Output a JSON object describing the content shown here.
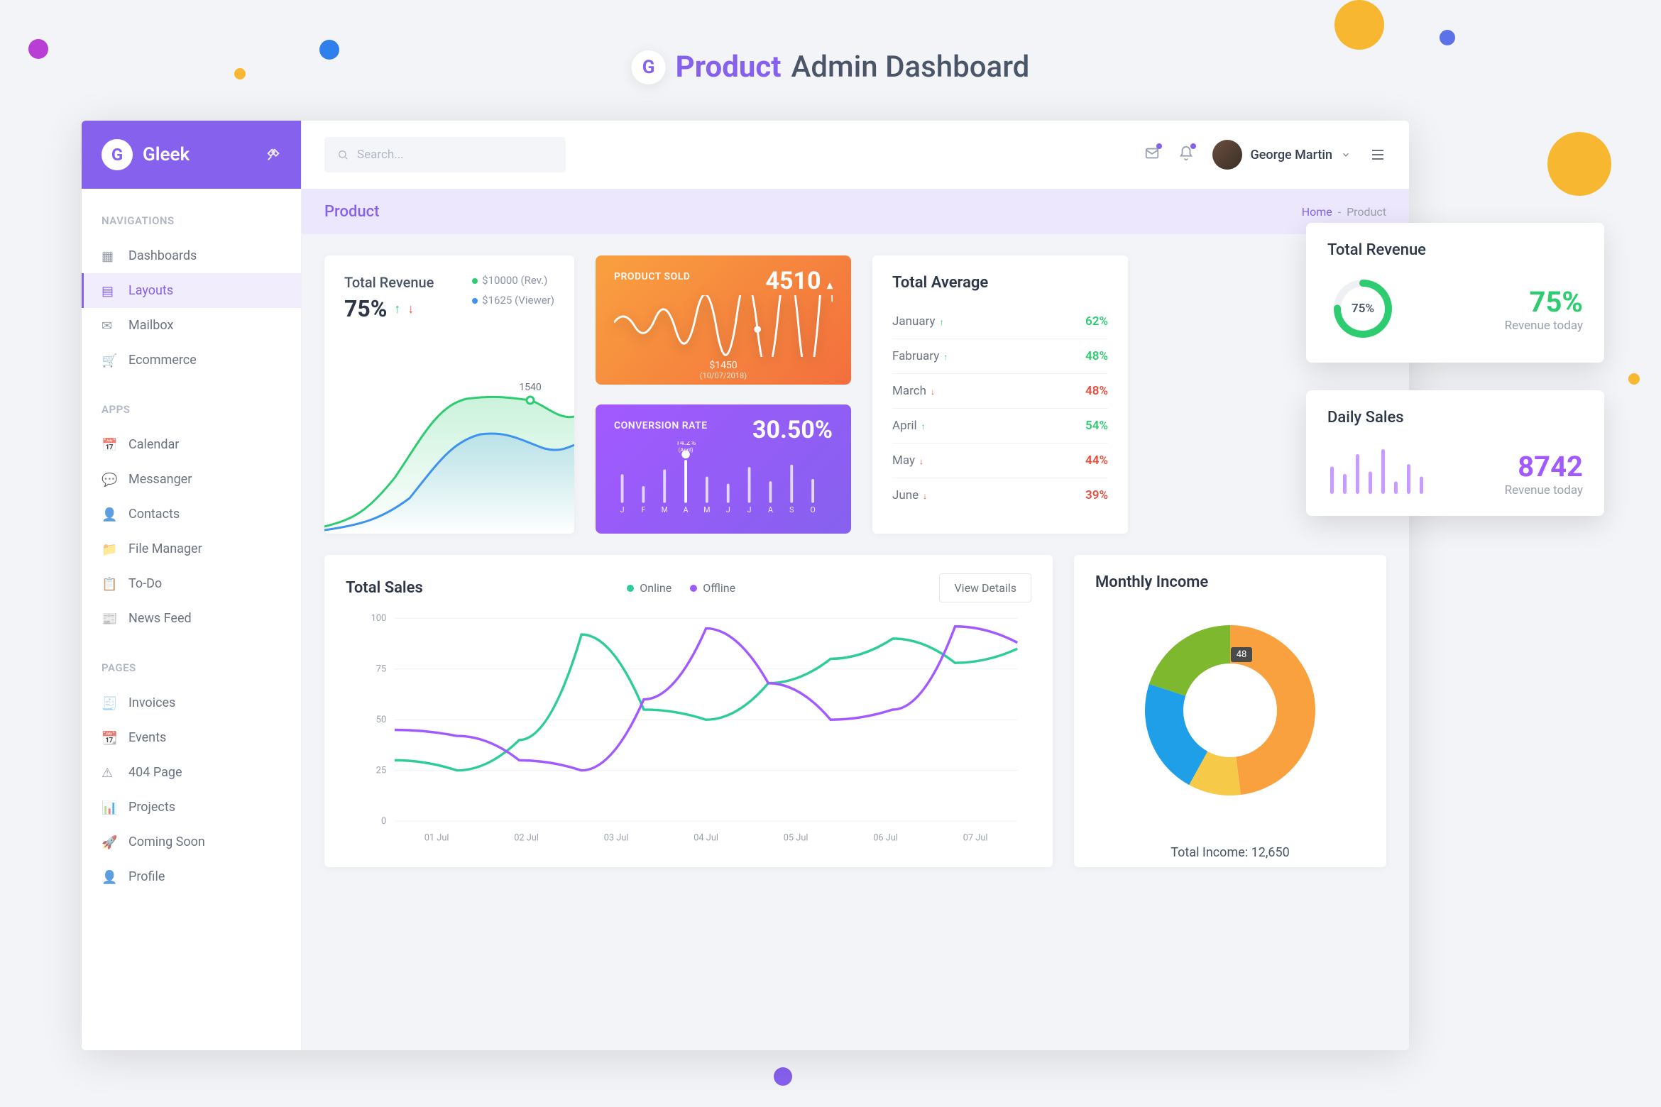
{
  "page_heading": {
    "prefix": "Product",
    "suffix": "Admin Dashboard"
  },
  "brand": "Gleek",
  "search_placeholder": "Search...",
  "user_name": "George Martin",
  "sidebar": {
    "sections": [
      {
        "title": "NAVIGATIONS",
        "items": [
          "Dashboards",
          "Layouts",
          "Mailbox",
          "Ecommerce"
        ]
      },
      {
        "title": "APPS",
        "items": [
          "Calendar",
          "Messanger",
          "Contacts",
          "File Manager",
          "To-Do",
          "News Feed"
        ]
      },
      {
        "title": "PAGES",
        "items": [
          "Invoices",
          "Events",
          "404 Page",
          "Projects",
          "Coming Soon",
          "Profile"
        ]
      }
    ],
    "active": "Layouts"
  },
  "breadcrumb": {
    "title": "Product",
    "home": "Home",
    "current": "Product",
    "sep": "-"
  },
  "total_revenue": {
    "title": "Total Revenue",
    "pct": "75%",
    "legend": [
      {
        "color": "#2ecc71",
        "label": "$10000 (Rev.)"
      },
      {
        "color": "#3e92f0",
        "label": "$1625 (Viewer)"
      }
    ],
    "point_label": "1540"
  },
  "product_sold": {
    "label": "PRODUCT SOLD",
    "value": "4510",
    "tooltip_value": "$1450",
    "tooltip_date": "(10/07/2018)"
  },
  "conversion": {
    "label": "CONVERSION RATE",
    "value": "30.50%",
    "highlight_pct": "14.2%",
    "highlight_month": "(April)",
    "months": [
      "J",
      "F",
      "M",
      "A",
      "M",
      "J",
      "J",
      "A",
      "S",
      "O"
    ]
  },
  "total_average": {
    "title": "Total Average",
    "rows": [
      {
        "month": "January",
        "pct": "62%",
        "dir": "up"
      },
      {
        "month": "Fabruary",
        "pct": "48%",
        "dir": "up"
      },
      {
        "month": "March",
        "pct": "48%",
        "dir": "down"
      },
      {
        "month": "April",
        "pct": "54%",
        "dir": "up"
      },
      {
        "month": "May",
        "pct": "44%",
        "dir": "down"
      },
      {
        "month": "June",
        "pct": "39%",
        "dir": "down"
      }
    ]
  },
  "float_revenue": {
    "title": "Total Revenue",
    "gauge_label": "75%",
    "big": "75%",
    "sub": "Revenue today"
  },
  "float_daily": {
    "title": "Daily Sales",
    "big": "8742",
    "sub": "Revenue today"
  },
  "total_sales": {
    "title": "Total Sales",
    "legend": [
      {
        "color": "#2ecc9b",
        "label": "Online"
      },
      {
        "color": "#a259ff",
        "label": "Offline"
      }
    ],
    "button": "View Details"
  },
  "monthly_income": {
    "title": "Monthly Income",
    "badge": "48",
    "total_label": "Total Income:",
    "total_value": "12,650"
  },
  "chart_data": {
    "total_revenue_spark": {
      "type": "area",
      "series": [
        {
          "name": "Rev.",
          "color": "#2ecc71",
          "values": [
            10,
            15,
            30,
            58,
            70,
            72,
            74,
            78,
            74,
            60,
            62
          ]
        },
        {
          "name": "Viewer",
          "color": "#3e92f0",
          "values": [
            5,
            8,
            18,
            38,
            50,
            56,
            58,
            55,
            48,
            40,
            45
          ]
        }
      ],
      "point": {
        "series": 0,
        "index": 8,
        "label": "1540"
      }
    },
    "product_sold_spark": {
      "type": "line",
      "values": [
        40,
        55,
        35,
        50,
        30,
        45,
        25,
        48,
        28,
        55,
        38,
        60,
        50,
        72,
        80
      ],
      "style": "white-squiggle"
    },
    "conversion_bars": {
      "type": "bar",
      "categories": [
        "J",
        "F",
        "M",
        "A",
        "M",
        "J",
        "J",
        "A",
        "S",
        "O"
      ],
      "values": [
        60,
        35,
        70,
        90,
        55,
        40,
        75,
        45,
        80,
        50
      ],
      "highlight_index": 3
    },
    "float_revenue_gauge": {
      "type": "gauge",
      "pct": 75,
      "color": "#2ecc71"
    },
    "daily_sales_bars": {
      "type": "bar",
      "values": [
        55,
        40,
        80,
        45,
        90,
        25,
        60,
        35
      ],
      "color": "#a259ff"
    },
    "total_sales_lines": {
      "type": "line",
      "x": [
        "01 Jul",
        "02 Jul",
        "03 Jul",
        "04 Jul",
        "05 Jul",
        "06 Jul",
        "07 Jul"
      ],
      "ylim": [
        0,
        100
      ],
      "yticks": [
        0,
        25,
        50,
        75,
        100
      ],
      "series": [
        {
          "name": "Online",
          "color": "#2ecc9b",
          "values": [
            30,
            25,
            40,
            92,
            55,
            50,
            68,
            80,
            90,
            78,
            85
          ]
        },
        {
          "name": "Offline",
          "color": "#a259ff",
          "values": [
            45,
            42,
            30,
            25,
            60,
            95,
            68,
            50,
            55,
            96,
            88
          ]
        }
      ]
    },
    "monthly_income_donut": {
      "type": "pie",
      "segments": [
        {
          "color": "#f9a03f",
          "value": 48
        },
        {
          "color": "#f7c948",
          "value": 10
        },
        {
          "color": "#1e9fe8",
          "value": 22
        },
        {
          "color": "#7db82f",
          "value": 20
        }
      ]
    }
  }
}
